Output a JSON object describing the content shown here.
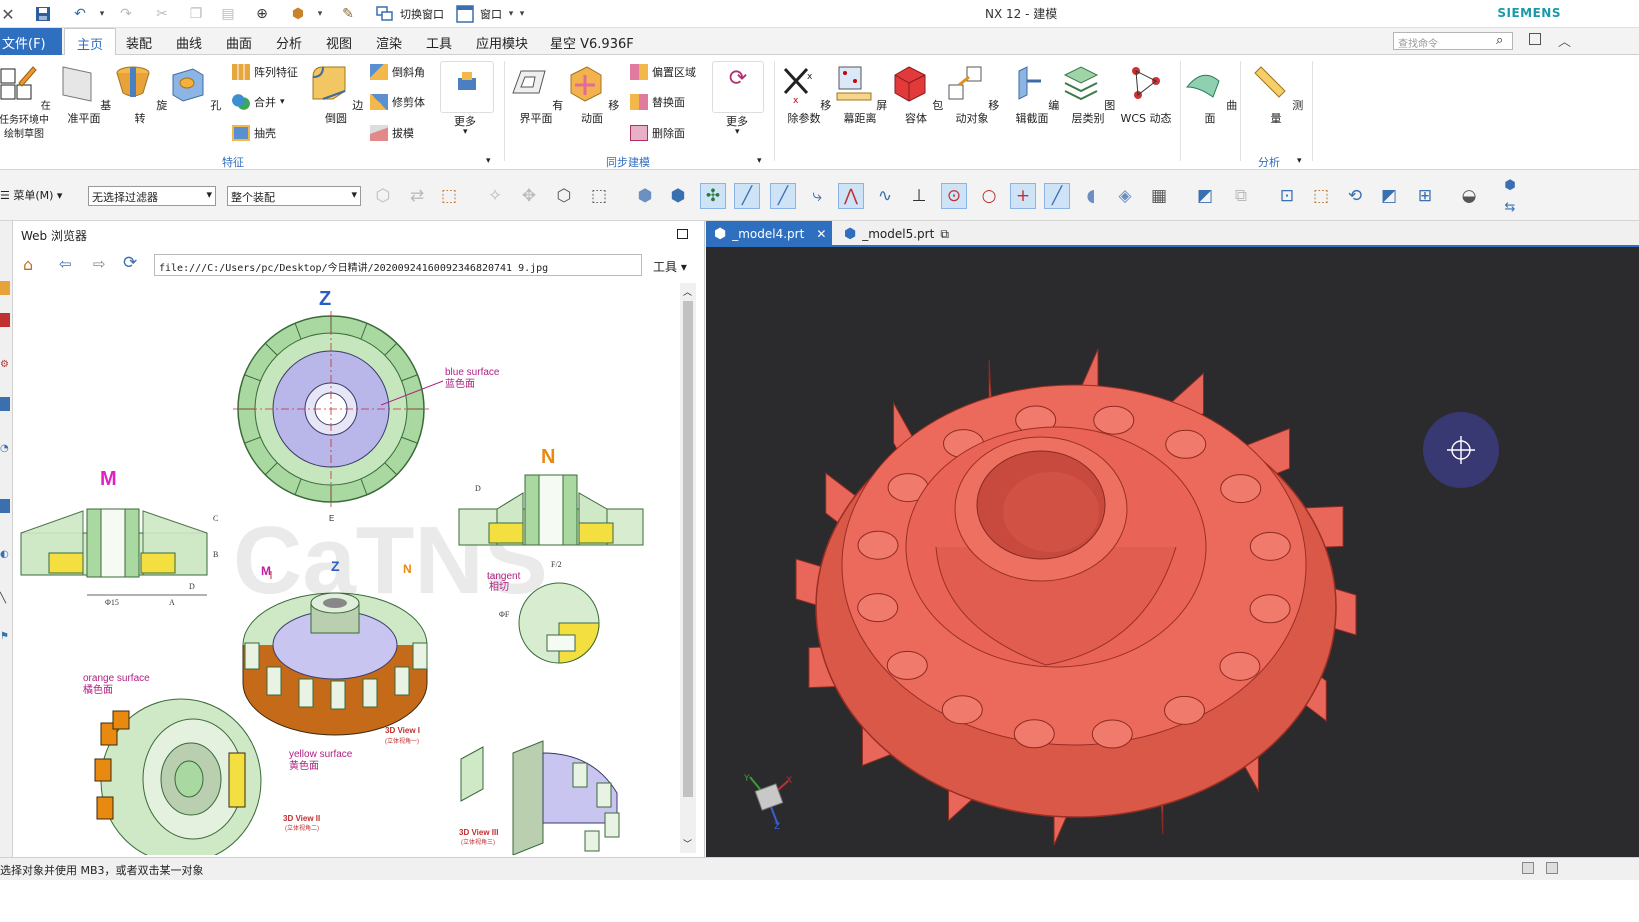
{
  "window": {
    "title": "NX 12 - 建模",
    "brand": "SIEMENS"
  },
  "quickaccess": {
    "switch_window": "切换窗口",
    "window_menu": "窗口"
  },
  "menu": {
    "file": "文件(F)",
    "tabs": [
      "主页",
      "装配",
      "曲线",
      "曲面",
      "分析",
      "视图",
      "渲染",
      "工具",
      "应用模块",
      "星空 V6.936F"
    ],
    "search_placeholder": "查找命令"
  },
  "ribbon": {
    "sketch": "在任务环境中绘制草图",
    "datum_plane": "基准平面",
    "revolve": "旋转",
    "hole": "孔",
    "pattern_feature": "阵列特征",
    "unite": "合并",
    "shell": "抽壳",
    "edge_blend": "边倒圆",
    "chamfer": "倒斜角",
    "trim_body": "修剪体",
    "draft": "拔模",
    "more1": "更多",
    "group_feature": "特征",
    "offset_face_plane": "有界平面",
    "move_face": "移动面",
    "offset_region": "偏置区域",
    "replace_face": "替换面",
    "delete_face": "删除面",
    "more2": "更多",
    "group_sync": "同步建模",
    "remove_params": "移除参数",
    "screen_distance": "屏幕距离",
    "wrap_body": "包容体",
    "move_object": "移动对象",
    "edit_section": "编辑截面",
    "layer_category": "图层类别",
    "wcs_dynamic": "WCS 动态",
    "surface": "曲面",
    "measure": "测量",
    "group_analysis": "分析"
  },
  "toolbar2": {
    "menu": "菜单(M)",
    "filter": "无选择过滤器",
    "scope": "整个装配"
  },
  "webpanel": {
    "title": "Web 浏览器",
    "url": "file:///C:/Users/pc/Desktop/今日精讲/20200924160092346820741 9.jpg",
    "tools": "工具"
  },
  "drawing": {
    "label_z": "Z",
    "label_m": "M",
    "label_n": "N",
    "blue_en": "blue surface",
    "blue_cn": "蓝色面",
    "orange_en": "orange surface",
    "orange_cn": "橘色面",
    "yellow_en": "yellow surface",
    "yellow_cn": "黄色面",
    "tangent_en": "tangent",
    "tangent_cn": "相切",
    "view1": "3D View I",
    "view1_cn": "(立体视角一)",
    "view2": "3D View II",
    "view2_cn": "(立体视角二)",
    "view3": "3D View III",
    "view3_cn": "(立体视角三)",
    "dim_15": "Φ15",
    "dim_a": "A",
    "dim_b": "B",
    "dim_c": "C",
    "dim_d": "D",
    "dim_e": "E",
    "dim_f": "ΦF",
    "dim_f2": "F/2"
  },
  "viewport": {
    "tabs": [
      "_model4.prt",
      "_model5.prt"
    ],
    "model_color": "#e8675a"
  },
  "status": {
    "text": "选择对象并使用 MB3，或者双击某一对象"
  }
}
